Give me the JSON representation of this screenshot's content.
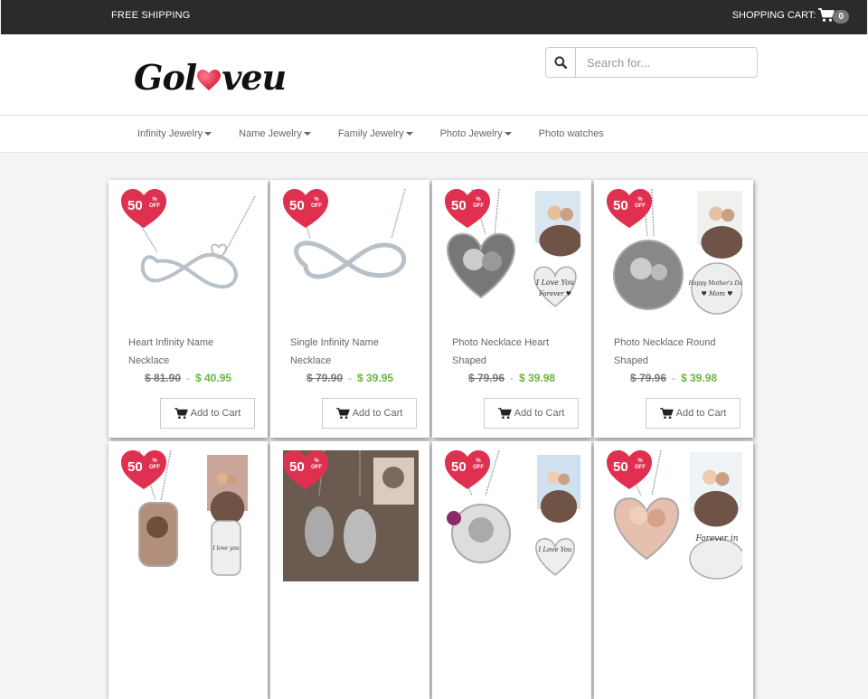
{
  "topbar": {
    "shipping": "FREE SHIPPING",
    "cart_label": "SHOPPING CART:",
    "cart_count": "0"
  },
  "brand": {
    "logo_left": "Gol",
    "logo_right": "veu"
  },
  "search": {
    "placeholder": "Search for...",
    "value": ""
  },
  "nav": [
    {
      "label": "Infinity Jewelry",
      "dropdown": true
    },
    {
      "label": "Name Jewelry",
      "dropdown": true
    },
    {
      "label": "Family Jewelry",
      "dropdown": true
    },
    {
      "label": "Photo Jewelry",
      "dropdown": true
    },
    {
      "label": "Photo watches",
      "dropdown": false
    }
  ],
  "badge": {
    "value": "50",
    "pct": "%",
    "off": "OFF"
  },
  "products": [
    {
      "name": "Heart Infinity Name Necklace",
      "old_price": "$ 81.90",
      "sep": "-",
      "new_price": "$ 40.95",
      "button": "Add to Cart",
      "image": "infinity-heart"
    },
    {
      "name": "Single Infinity Name Necklace",
      "old_price": "$ 79.90",
      "sep": "-",
      "new_price": "$ 39.95",
      "button": "Add to Cart",
      "image": "infinity"
    },
    {
      "name": "Photo Necklace Heart Shaped",
      "old_price": "$ 79.96",
      "sep": "-",
      "new_price": "$ 39.98",
      "button": "Add to Cart",
      "image": "photo-heart",
      "engraving": [
        "I Love You",
        "Forever ♥"
      ]
    },
    {
      "name": "Photo Necklace Round Shaped",
      "old_price": "$ 79.96",
      "sep": "-",
      "new_price": "$ 39.98",
      "button": "Add to Cart",
      "image": "photo-round",
      "engraving": [
        "Happy Mother's Day",
        "♥ Mom ♥"
      ]
    },
    {
      "name": "",
      "old_price": "",
      "sep": "",
      "new_price": "",
      "button": "",
      "image": "dog-tag",
      "engraving": [
        "I love you"
      ]
    },
    {
      "name": "",
      "old_price": "",
      "sep": "",
      "new_price": "",
      "button": "",
      "image": "pet-photo"
    },
    {
      "name": "",
      "old_price": "",
      "sep": "",
      "new_price": "",
      "button": "",
      "image": "baby-photo",
      "engraving": [
        "I Love You"
      ]
    },
    {
      "name": "",
      "old_price": "",
      "sep": "",
      "new_price": "",
      "button": "",
      "image": "couple-heart",
      "engraving": [
        "Forever in"
      ]
    }
  ],
  "colors": {
    "topbar": "#2b2b2b",
    "price_new": "#6ab63c",
    "badge": "#e0304f"
  }
}
